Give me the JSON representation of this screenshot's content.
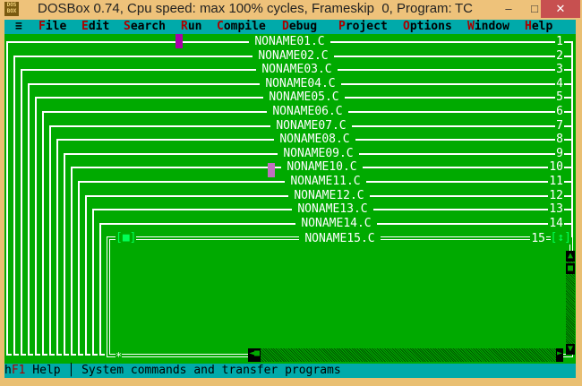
{
  "window": {
    "title": "DOSBox 0.74, Cpu speed: max 100% cycles, Frameskip  0, Program:",
    "program": "TC",
    "icon_text": "DOS BOX",
    "min": "–",
    "max": "□",
    "close": "✕"
  },
  "menu": [
    {
      "hotkey": "≡",
      "rest": ""
    },
    {
      "hotkey": "F",
      "rest": "ile"
    },
    {
      "hotkey": "E",
      "rest": "dit"
    },
    {
      "hotkey": "S",
      "rest": "earch"
    },
    {
      "hotkey": "R",
      "rest": "un"
    },
    {
      "hotkey": "C",
      "rest": "ompile"
    },
    {
      "hotkey": "D",
      "rest": "ebug"
    },
    {
      "hotkey": "P",
      "rest": "roject"
    },
    {
      "hotkey": "O",
      "rest": "ptions"
    },
    {
      "hotkey": "W",
      "rest": "indow"
    },
    {
      "hotkey": "H",
      "rest": "elp"
    }
  ],
  "windows": [
    {
      "title": "NONAME01.C",
      "number": "1"
    },
    {
      "title": "NONAME02.C",
      "number": "2"
    },
    {
      "title": "NONAME03.C",
      "number": "3"
    },
    {
      "title": "NONAME04.C",
      "number": "4"
    },
    {
      "title": "NONAME05.C",
      "number": "5"
    },
    {
      "title": "NONAME06.C",
      "number": "6"
    },
    {
      "title": "NONAME07.C",
      "number": "7"
    },
    {
      "title": "NONAME08.C",
      "number": "8"
    },
    {
      "title": "NONAME09.C",
      "number": "9"
    },
    {
      "title": "NONAME10.C",
      "number": "10"
    },
    {
      "title": "NONAME11.C",
      "number": "11"
    },
    {
      "title": "NONAME12.C",
      "number": "12"
    },
    {
      "title": "NONAME13.C",
      "number": "13"
    },
    {
      "title": "NONAME14.C",
      "number": "14"
    },
    {
      "title": "NONAME15.C",
      "number": "15"
    }
  ],
  "active_window": {
    "close_box": "[■]",
    "zoom_box": "[↕]",
    "position": "*"
  },
  "status": {
    "prefix": "h",
    "key": "F1",
    "label": " Help │ System commands and transfer programs"
  }
}
